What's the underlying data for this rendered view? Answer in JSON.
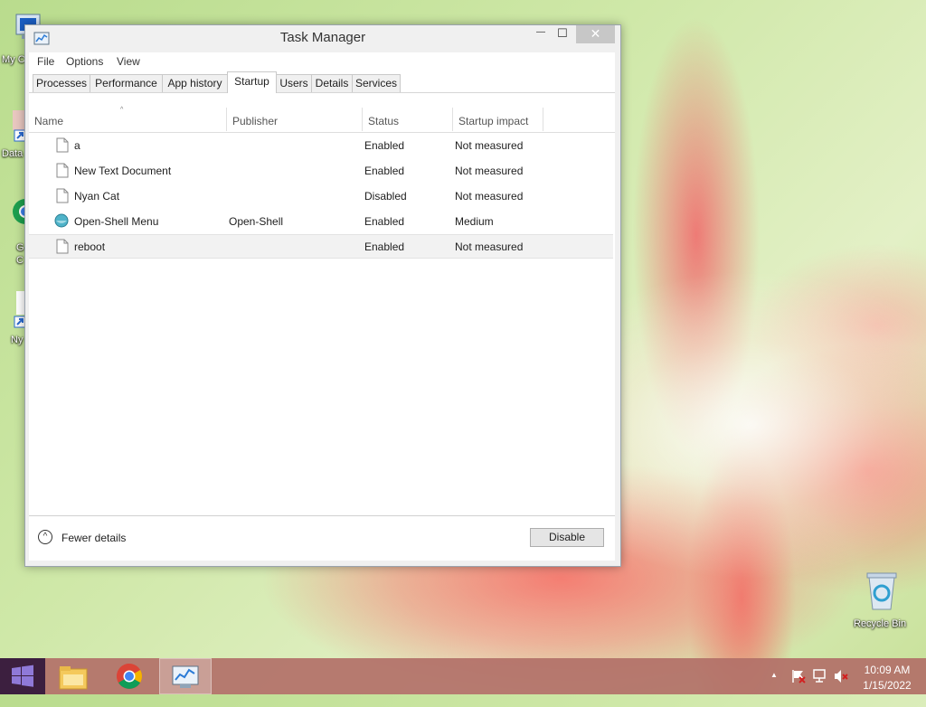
{
  "desktop": {
    "icons": [
      {
        "label": "My C"
      },
      {
        "label": "Data"
      },
      {
        "label": "G"
      },
      {
        "label": "C"
      },
      {
        "label": "Ny"
      }
    ],
    "recycle_bin": {
      "label": "Recycle Bin"
    }
  },
  "window": {
    "title": "Task Manager",
    "controls": {
      "minimize": "—",
      "maximize": "☐",
      "close": "✕"
    },
    "menu": [
      "File",
      "Options",
      "View"
    ],
    "tabs": [
      "Processes",
      "Performance",
      "App history",
      "Startup",
      "Users",
      "Details",
      "Services"
    ],
    "active_tab": "Startup",
    "columns": [
      "Name",
      "Publisher",
      "Status",
      "Startup impact"
    ],
    "sort_indicator": "^",
    "rows": [
      {
        "name": "a",
        "publisher": "",
        "status": "Enabled",
        "impact": "Not measured",
        "icon": "file-icon"
      },
      {
        "name": "New Text Document",
        "publisher": "",
        "status": "Enabled",
        "impact": "Not measured",
        "icon": "file-icon"
      },
      {
        "name": "Nyan Cat",
        "publisher": "",
        "status": "Disabled",
        "impact": "Not measured",
        "icon": "file-icon"
      },
      {
        "name": "Open-Shell Menu",
        "publisher": "Open-Shell",
        "status": "Enabled",
        "impact": "Medium",
        "icon": "shell-icon"
      },
      {
        "name": "reboot",
        "publisher": "",
        "status": "Enabled",
        "impact": "Not measured",
        "icon": "file-icon",
        "selected": true
      }
    ],
    "footer": {
      "fewer_details": "Fewer details",
      "fewer_symbol": "^",
      "disable": "Disable"
    }
  },
  "taskbar": {
    "clock_time": "10:09 AM",
    "clock_date": "1/15/2022",
    "tray_arrow": "▲"
  },
  "colors": {
    "accent": "#3c1f3f",
    "taskbar": "#b27068",
    "selected_row": "#f2f2f2"
  }
}
